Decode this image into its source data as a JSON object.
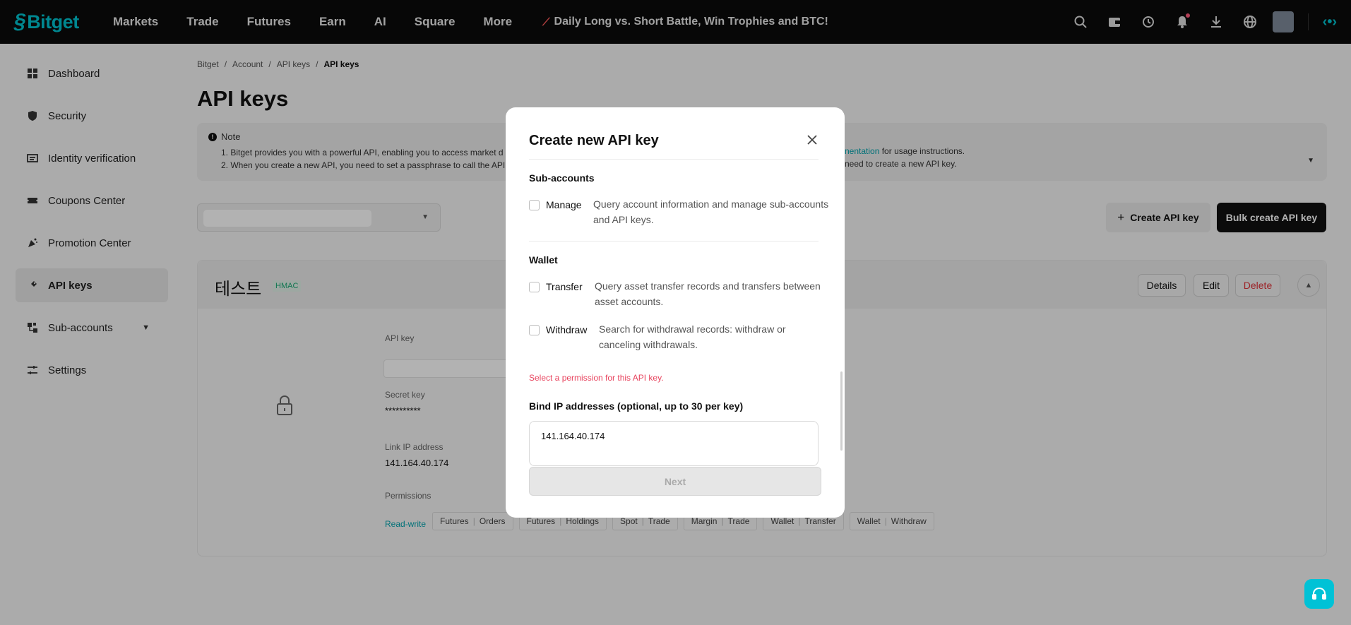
{
  "nav": {
    "brand": "Bitget",
    "items": [
      "Markets",
      "Trade",
      "Futures",
      "Earn",
      "AI",
      "Square",
      "More"
    ],
    "promo": "Daily Long vs. Short Battle, Win Trophies and BTC!"
  },
  "sidebar": {
    "items": [
      {
        "label": "Dashboard",
        "icon": "dashboard-icon"
      },
      {
        "label": "Security",
        "icon": "shield-icon"
      },
      {
        "label": "Identity verification",
        "icon": "id-card-icon"
      },
      {
        "label": "Coupons Center",
        "icon": "coupon-icon"
      },
      {
        "label": "Promotion Center",
        "icon": "promotion-icon"
      },
      {
        "label": "API keys",
        "icon": "api-key-icon"
      },
      {
        "label": "Sub-accounts",
        "icon": "sub-accounts-icon"
      },
      {
        "label": "Settings",
        "icon": "settings-icon"
      }
    ],
    "active_index": 5
  },
  "breadcrumb": [
    "Bitget",
    "Account",
    "API keys",
    "API keys"
  ],
  "page": {
    "title": "API keys",
    "note_title": "Note",
    "note_lines": [
      "1.  Bitget provides you with a powerful API, enabling you to access market d",
      "2.  When you create a new API, you need to set a passphrase to call the API"
    ],
    "note_line1_link": "nentation",
    "note_line1_tail": " for usage instructions.",
    "note_line2_tail": "need to create a new API key.",
    "create_label": "Create API key",
    "bulk_label": "Bulk create API key"
  },
  "card": {
    "name": "테스트",
    "tag": "HMAC",
    "details": "Details",
    "edit": "Edit",
    "delete": "Delete",
    "api_key_label": "API key",
    "secret_label": "Secret key",
    "secret_value": "**********",
    "ip_label": "Link IP address",
    "ip_value": "141.164.40.174",
    "perm_label": "Permissions",
    "perm_mode": "Read-write",
    "perm_tags": [
      [
        "Futures",
        "Orders"
      ],
      [
        "Futures",
        "Holdings"
      ],
      [
        "Spot",
        "Trade"
      ],
      [
        "Margin",
        "Trade"
      ],
      [
        "Wallet",
        "Transfer"
      ],
      [
        "Wallet",
        "Withdraw"
      ]
    ]
  },
  "modal": {
    "title": "Create new API key",
    "sub_accounts_title": "Sub-accounts",
    "manage_label": "Manage",
    "manage_desc_1": "Query account information and manage sub-accounts",
    "manage_desc_2": "and API keys.",
    "wallet_title": "Wallet",
    "transfer_label": "Transfer",
    "transfer_desc_1": "Query asset transfer records and transfers between",
    "transfer_desc_2": "asset accounts.",
    "withdraw_label": "Withdraw",
    "withdraw_desc_1": "Search for withdrawal records: withdraw or",
    "withdraw_desc_2": "canceling withdrawals.",
    "error": "Select a permission for this API key.",
    "ip_title": "Bind IP addresses (optional, up to 30 per key)",
    "ip_value": "141.164.40.174",
    "next": "Next"
  }
}
